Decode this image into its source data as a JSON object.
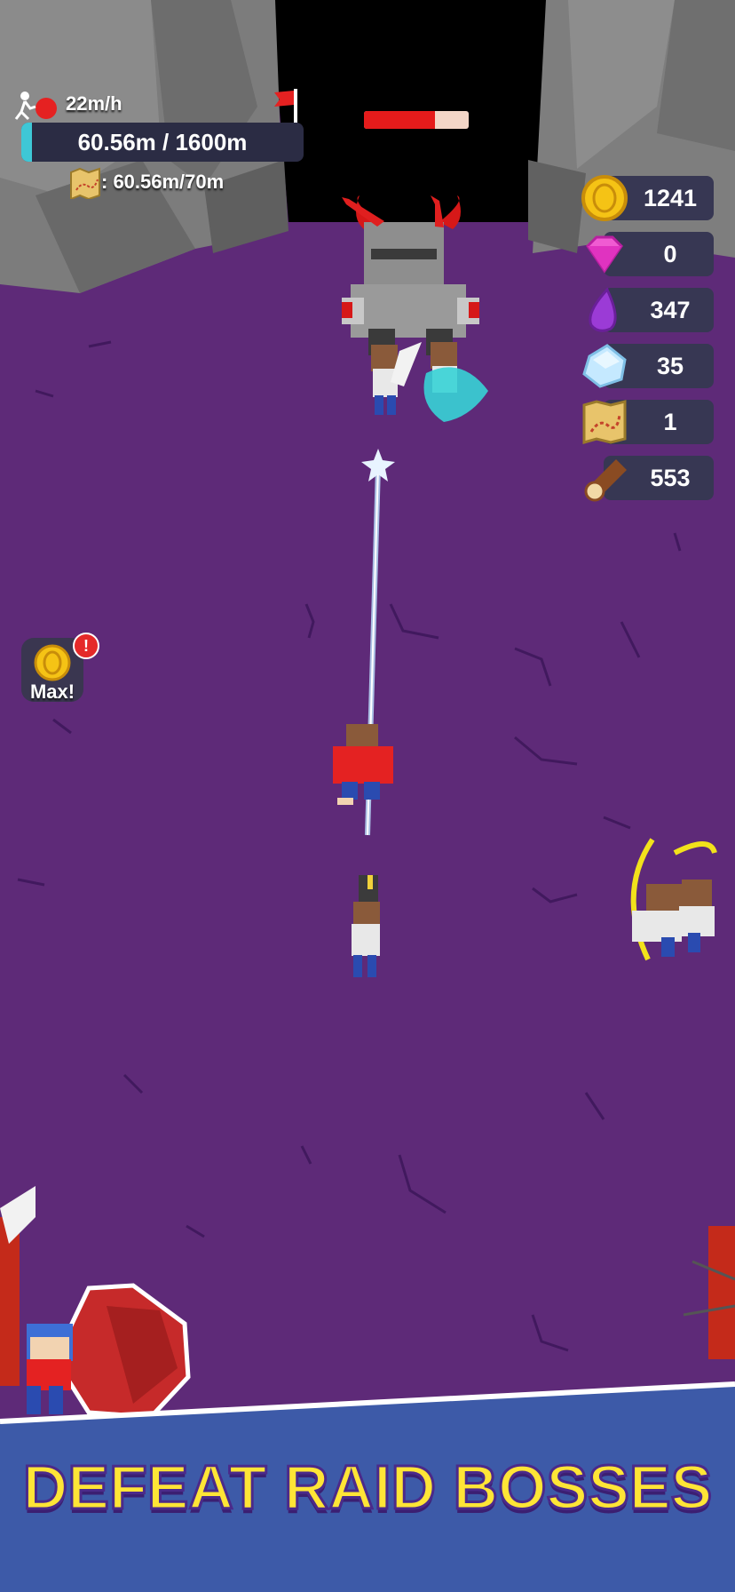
{
  "hud": {
    "speed": "22m/h",
    "distance": "60.56m / 1600m",
    "distance_progress": 0.0379,
    "map_progress": ": 60.56m/70m"
  },
  "boss": {
    "health_fraction": 0.68
  },
  "resources": [
    {
      "icon": "gold-coin-icon",
      "value": "1241"
    },
    {
      "icon": "pink-gem-icon",
      "value": "0"
    },
    {
      "icon": "purple-drop-icon",
      "value": "347"
    },
    {
      "icon": "ice-crystal-icon",
      "value": "35"
    },
    {
      "icon": "treasure-map-icon",
      "value": "1"
    },
    {
      "icon": "wood-log-icon",
      "value": "553"
    }
  ],
  "coin_button": {
    "label": "Max!",
    "badge": "!"
  },
  "banner": {
    "text": "DEFEAT RAID BOSSES"
  },
  "colors": {
    "ground": "#5e2a78",
    "banner_bg": "#3d5aa8",
    "banner_text": "#ffe536",
    "progress_fill": "#3ec7d6",
    "boss_health": "#e51b1b"
  }
}
